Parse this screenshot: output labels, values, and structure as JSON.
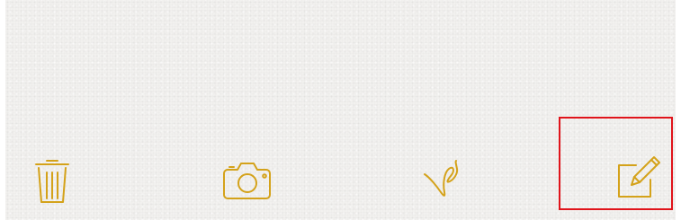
{
  "toolbar": {
    "items": [
      {
        "id": "delete",
        "icon": "trash-icon"
      },
      {
        "id": "camera",
        "icon": "camera-icon"
      },
      {
        "id": "sketch",
        "icon": "sketch-squiggle-icon"
      },
      {
        "id": "compose",
        "icon": "compose-icon"
      }
    ],
    "accent_color": "#d4a21a",
    "highlight_color": "#e0141b",
    "highlighted_item": "compose"
  }
}
